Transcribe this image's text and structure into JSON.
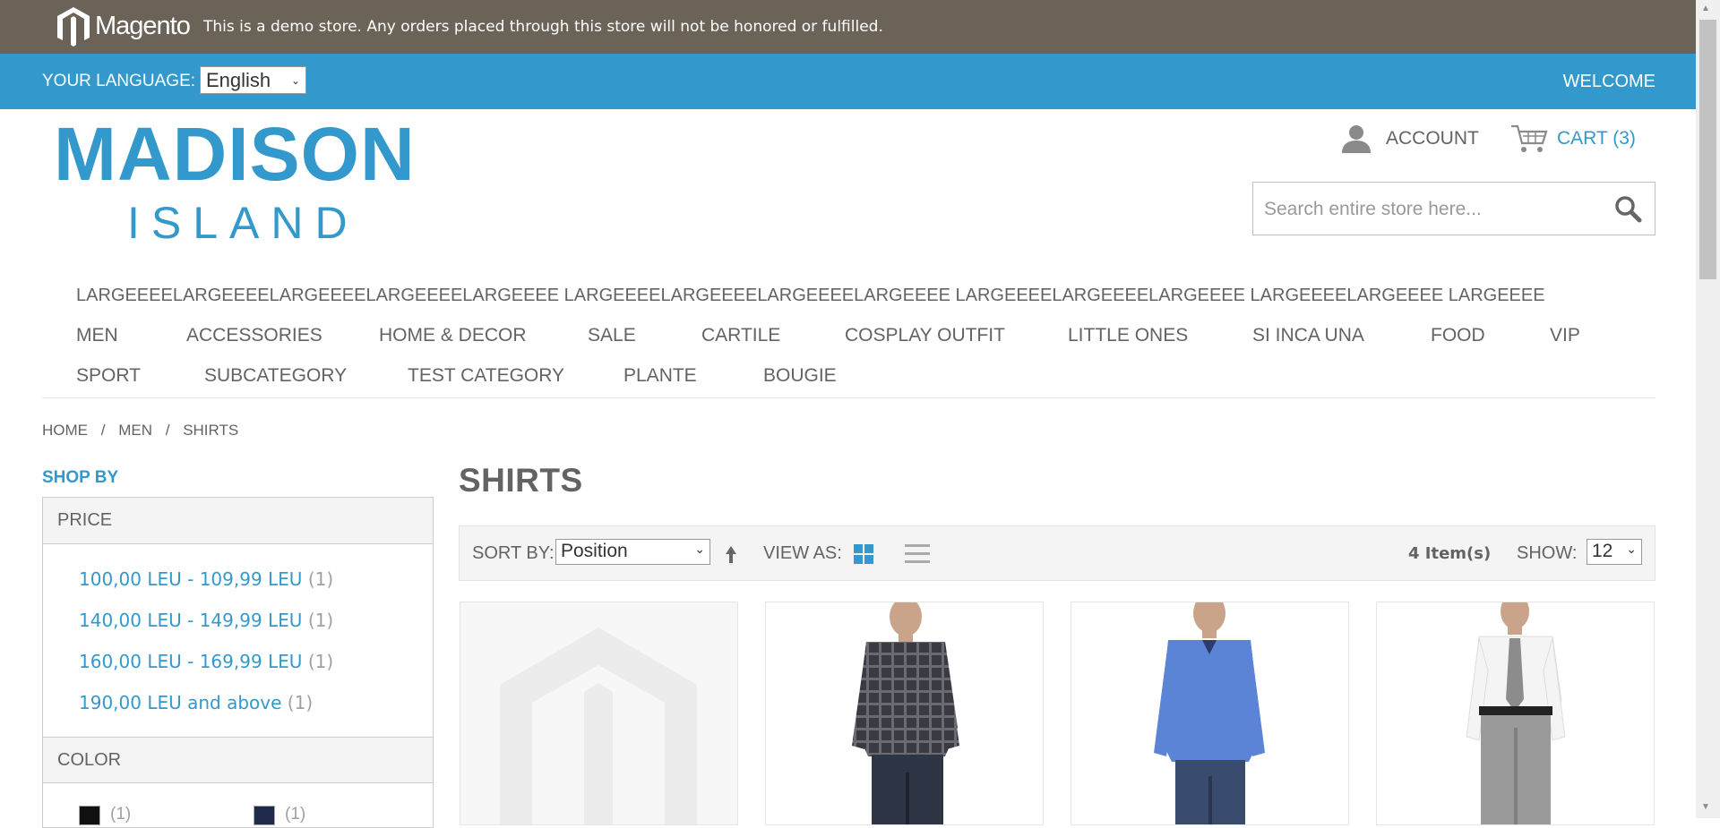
{
  "demo_notice": {
    "brand": "Magento",
    "text": "This is a demo store. Any orders placed through this store will not be honored or fulfilled."
  },
  "language_bar": {
    "label": "YOUR LANGUAGE:",
    "selected_language": "English",
    "welcome": "WELCOME"
  },
  "logo": {
    "line1": "MADISON",
    "line2": "ISLAND"
  },
  "header": {
    "account_label": "ACCOUNT",
    "cart_label": "CART (3)",
    "search_placeholder": "Search entire store here...",
    "account_icon": "user-icon",
    "cart_icon": "shopping-cart-icon",
    "search_icon": "magnifier-icon"
  },
  "nav": {
    "row1": "LARGEEEELARGEEEELARGEEEELARGEEEELARGEEEE LARGEEEELARGEEEELARGEEEELARGEEEE LARGEEEELARGEEEELARGEEEE LARGEEEELARGEEEE LARGEEEE",
    "row2": [
      "MEN",
      "ACCESSORIES",
      "HOME & DECOR",
      "SALE",
      "CARTILE",
      "COSPLAY OUTFIT",
      "LITTLE ONES",
      "SI INCA UNA",
      "FOOD",
      "VIP"
    ],
    "row3": [
      "SPORT",
      "SUBCATEGORY",
      "TEST CATEGORY",
      "PLANTE",
      "BOUGIE"
    ]
  },
  "breadcrumb": [
    "HOME",
    "/",
    "MEN",
    "/",
    "SHIRTS"
  ],
  "sidebar": {
    "title": "SHOP BY",
    "price_heading": "PRICE",
    "prices": [
      {
        "label": "100,00 LEU - 109,99 LEU",
        "count": "(1)"
      },
      {
        "label": "140,00 LEU - 149,99 LEU",
        "count": "(1)"
      },
      {
        "label": "160,00 LEU - 169,99 LEU",
        "count": "(1)"
      },
      {
        "label": "190,00 LEU and above",
        "count": "(1)"
      }
    ],
    "color_heading": "COLOR",
    "colors": [
      {
        "color": "#111111",
        "count": "(1)"
      },
      {
        "color": "#1f2a4a",
        "count": "(1)"
      }
    ]
  },
  "main": {
    "title": "SHIRTS",
    "sort_label": "SORT BY:",
    "sort_value": "Position",
    "view_label": "VIEW AS:",
    "items_count": "4 Item(s)",
    "show_label": "SHOW:",
    "show_value": "12"
  },
  "products": [
    {
      "image": "placeholder-image"
    },
    {
      "image": "plaid-shirt-image"
    },
    {
      "image": "blue-shirt-image"
    },
    {
      "image": "white-shirt-tie-image"
    }
  ],
  "colors": {
    "accent": "#3399cc",
    "demo_bar": "#6b6358",
    "text": "#636363"
  }
}
